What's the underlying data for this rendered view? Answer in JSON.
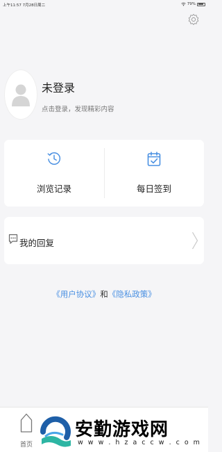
{
  "status_bar": {
    "time": "上午11:57",
    "date": "7月28日周二",
    "battery": "79%"
  },
  "profile": {
    "username": "未登录",
    "hint": "点击登录，发现精彩内容"
  },
  "actions": [
    {
      "label": "浏览记录",
      "icon": "history-clock-icon"
    },
    {
      "label": "每日签到",
      "icon": "calendar-check-icon"
    }
  ],
  "reply": {
    "label": "我的回复",
    "icon": "comment-icon"
  },
  "policy": {
    "user_agreement": "《用户协议》",
    "and": "和",
    "privacy_policy": "《隐私政策》"
  },
  "tabbar": {
    "home_label": "首页"
  },
  "watermark": {
    "title": "安勤游戏网",
    "url": "w w w . h z a c c w . c o m"
  },
  "colors": {
    "accent": "#4a90e2",
    "background": "#f5f5f7"
  }
}
